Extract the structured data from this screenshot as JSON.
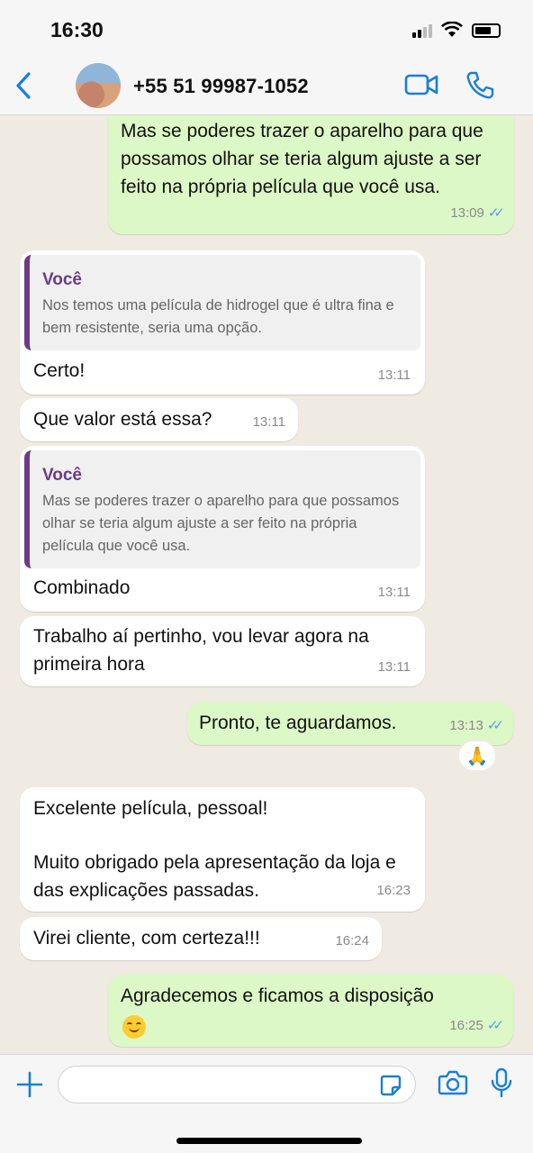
{
  "status_bar": {
    "time": "16:30"
  },
  "header": {
    "contact": "+55 51 99987-1052"
  },
  "messages": [
    {
      "text": "Mas se poderes trazer o aparelho para que possamos olhar se teria algum ajuste a ser feito na própria película que você usa.",
      "time": "13:09"
    },
    {
      "quote_author": "Você",
      "quote_text": "Nos temos uma película de hidrogel que é ultra fina e bem resistente, seria uma opção.",
      "text": "Certo!",
      "time": "13:11"
    },
    {
      "text": "Que valor está essa?",
      "time": "13:11"
    },
    {
      "quote_author": "Você",
      "quote_text": "Mas se poderes trazer o aparelho para que possamos olhar se teria algum ajuste a ser feito na própria película que você usa.",
      "text": "Combinado",
      "time": "13:11"
    },
    {
      "text": "Trabalho aí pertinho, vou levar agora na primeira hora",
      "time": "13:11"
    },
    {
      "text": "Pronto, te aguardamos.",
      "time": "13:13",
      "reaction": "🙏"
    },
    {
      "line1": "Excelente película, pessoal!",
      "line2": "Muito obrigado pela apresentação da loja e das explicações passadas.",
      "time": "16:23"
    },
    {
      "text": "Virei cliente, com certeza!!!",
      "time": "16:24"
    },
    {
      "text": "Agradecemos e ficamos a disposição",
      "time": "16:25",
      "emoji": "smiling-face"
    }
  ],
  "icons": {
    "back": "chevron-left-icon",
    "video": "video-call-icon",
    "phone": "phone-icon",
    "plus": "plus-icon",
    "sticker": "sticker-icon",
    "camera": "camera-icon",
    "mic": "microphone-icon",
    "read_receipt": "double-check-icon"
  },
  "colors": {
    "accent": "#1a7fd6",
    "outgoing": "#dcf8c6",
    "incoming": "#ffffff",
    "quote_author": "#6b3c86",
    "ticks": "#4fa3e0"
  },
  "composer": {
    "placeholder": ""
  }
}
